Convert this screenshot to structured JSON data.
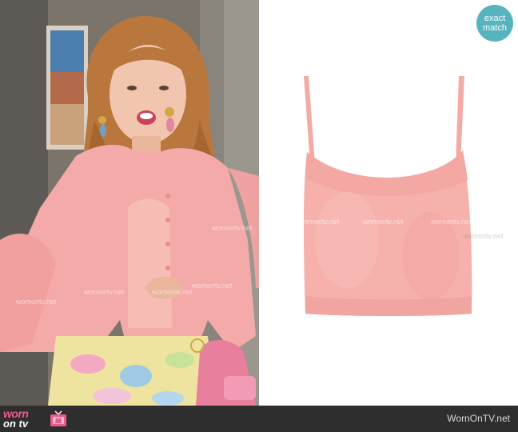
{
  "badge": {
    "line1": "exact",
    "line2": "match"
  },
  "watermark_text": "womontv.net",
  "footer": {
    "logo_top": "worn",
    "logo_bottom": "on tv",
    "site": "WornOnTV.net"
  },
  "colors": {
    "badge_teal": "#57b4be",
    "footer_bg": "#2e2e2e",
    "logo_pink": "#e95a8a",
    "top_pink": "#f6b1ad"
  }
}
